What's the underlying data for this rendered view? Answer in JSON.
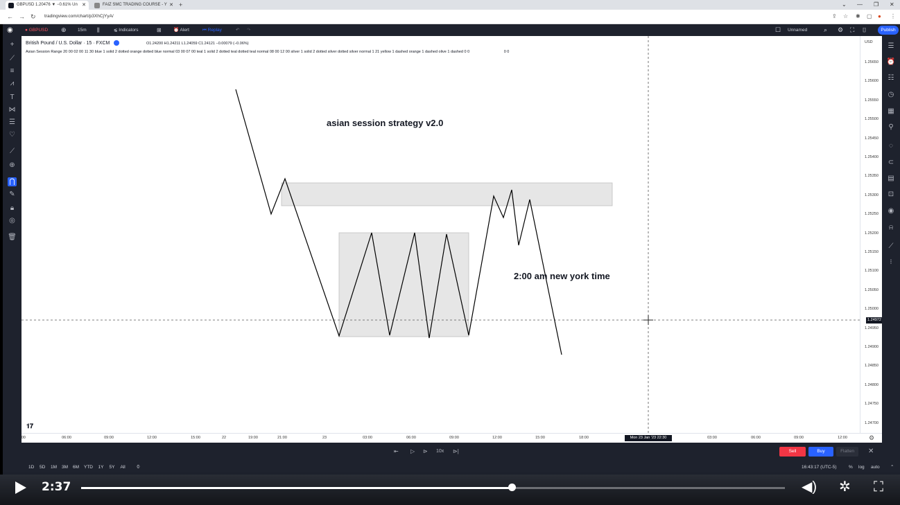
{
  "browser": {
    "tabs": [
      {
        "label": "GBPUSD 1.20476 ▼ −0.61% Un",
        "active": true
      },
      {
        "label": "FAIZ SMC TRADING COURSE - Y",
        "active": false
      }
    ],
    "new_tab": "+",
    "url": "tradingview.com/chart/p3XhCjYyA/"
  },
  "tv_header": {
    "symbol": "GBPUSD",
    "interval": "15m",
    "indicators": "Indicators",
    "alert": "Alert",
    "replay": "Replay",
    "layout_name": "Unnamed",
    "publish": "Publish"
  },
  "chart": {
    "title": "British Pound / U.S. Dollar · 15 · FXCM",
    "ohlc": "O1.24200 H1.24211 L1.24059 C1.24121 −0.00079 (−0.06%)",
    "indicator_line": "Asian Session Range 20 00 02 00 11 30 blue 1 solid 2 dotted orange dotted blue normal 03 00 07 00 teal 1 solid 2 dotted teal dotted teal normal 08 00 12 00 silver 1 solid 2 dotted silver dotted silver normal 1 21 yellow 1 dashed orange 1 dashed olive 1 dashed   0 0",
    "indicator_tail": "0 0",
    "annotation_title": "asian session strategy v2.0",
    "annotation_ny": "2:00 am new york time",
    "currency": "USD",
    "price_ticks": [
      "1.25650",
      "1.25600",
      "1.25550",
      "1.25500",
      "1.25450",
      "1.25400",
      "1.25350",
      "1.25300",
      "1.25250",
      "1.25200",
      "1.25150",
      "1.25100",
      "1.25050",
      "1.25000",
      "1.24950",
      "1.24900",
      "1.24850",
      "1.24800",
      "1.24750",
      "1.24700"
    ],
    "current_price": "1.24972",
    "time_ticks": [
      ":00",
      "06:00",
      "09:00",
      "12:00",
      "15:00",
      "22",
      "19:00",
      "21:00",
      "23",
      "03:00",
      "06:00",
      "09:00",
      "12:00",
      "15:00",
      "18:00",
      "03:00",
      "06:00",
      "09:00",
      "12:00"
    ],
    "crosshair_date": "Mon 23 Jan '23  22:30"
  },
  "replay": {
    "speed": "10x",
    "sell": "Sell",
    "buy": "Buy",
    "flatten": "Flatten"
  },
  "range_bar": {
    "ranges": [
      "1D",
      "5D",
      "1M",
      "3M",
      "6M",
      "YTD",
      "1Y",
      "5Y",
      "All"
    ],
    "clock": "16:43:17 (UTC-5)",
    "percent": "%",
    "log": "log",
    "auto": "auto"
  },
  "video": {
    "timecode": "2:37",
    "progress": 0.612
  }
}
